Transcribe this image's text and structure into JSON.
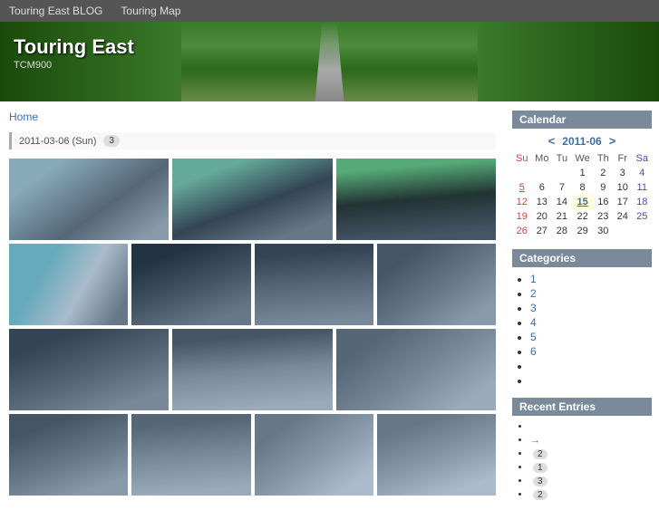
{
  "nav": {
    "items": [
      "Touring East BLOG",
      "Touring Map"
    ]
  },
  "header": {
    "title": "Touring East",
    "subtitle": "TCM900"
  },
  "breadcrumb": {
    "home": "Home"
  },
  "date_section": {
    "date": "2011-03-06 (Sun)",
    "count": "3"
  },
  "calendar": {
    "title": "Calendar",
    "month": "2011-06",
    "prev": "<",
    "next": ">",
    "days_header": [
      "Su",
      "Mo",
      "Tu",
      "We",
      "Th",
      "Fr",
      "Sa"
    ],
    "weeks": [
      [
        "",
        "",
        "",
        "1",
        "2",
        "3",
        "4"
      ],
      [
        "5",
        "6",
        "7",
        "8",
        "9",
        "10",
        "11"
      ],
      [
        "12",
        "13",
        "14",
        "15",
        "16",
        "17",
        "18"
      ],
      [
        "19",
        "20",
        "21",
        "22",
        "23",
        "24",
        "25"
      ],
      [
        "26",
        "27",
        "28",
        "29",
        "30",
        "",
        ""
      ]
    ],
    "today_date": "15",
    "linked_dates": [
      "5",
      "15"
    ]
  },
  "categories": {
    "title": "Categories",
    "items": [
      "1",
      "2",
      "3",
      "4",
      "5",
      "6",
      "",
      ""
    ]
  },
  "recent_entries": {
    "title": "Recent Entries",
    "items": [
      {
        "label": "",
        "badge": ""
      },
      {
        "label": "→",
        "badge": ""
      },
      {
        "label": "",
        "badge": "2"
      },
      {
        "label": "",
        "badge": "1"
      },
      {
        "label": "",
        "badge": "3"
      },
      {
        "label": "",
        "badge": "2"
      }
    ]
  },
  "photos": {
    "row1": [
      "photo-1",
      "photo-2",
      "photo-3"
    ],
    "row2": [
      "photo-4",
      "photo-5",
      "photo-6",
      "photo-7"
    ],
    "row3": [
      "photo-8",
      "photo-9",
      "photo-10"
    ],
    "row4": [
      "photo-11",
      "photo-12",
      "photo-13",
      "photo-14"
    ]
  }
}
